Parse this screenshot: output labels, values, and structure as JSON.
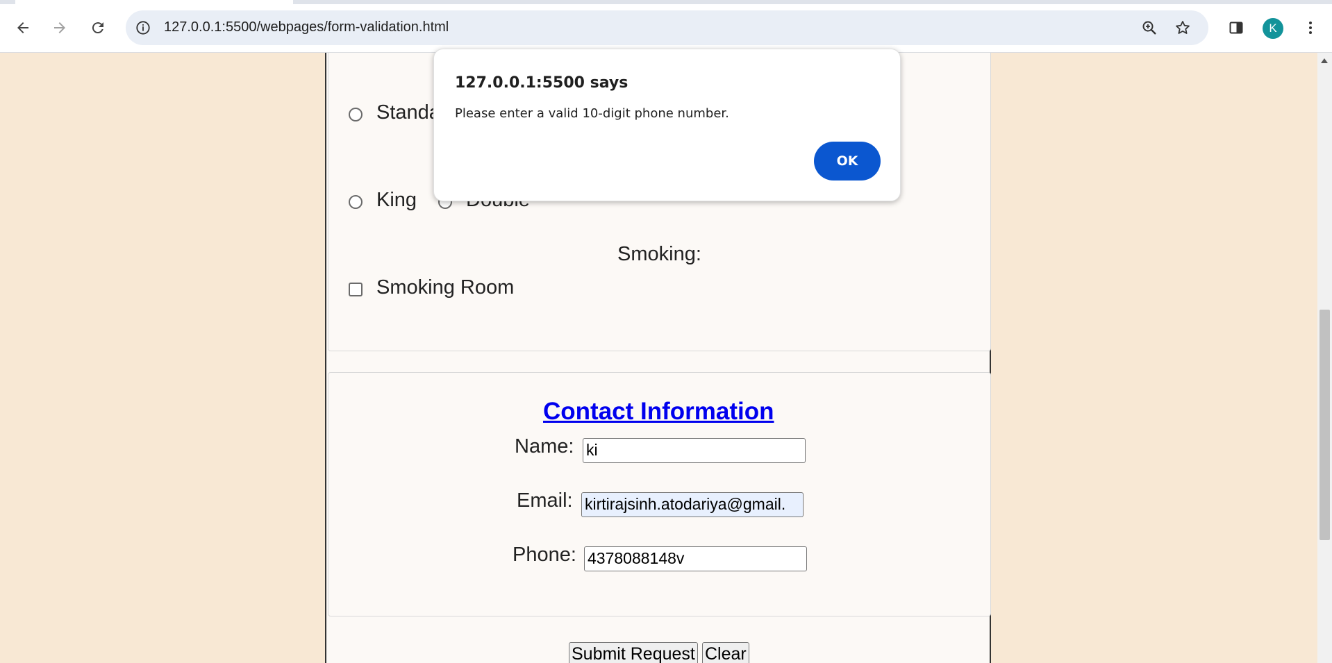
{
  "browser": {
    "url": "127.0.0.1:5500/webpages/form-validation.html",
    "avatar_initial": "K",
    "icons": {
      "back": "arrow-left-icon",
      "forward": "arrow-right-icon",
      "reload": "reload-icon",
      "site_info": "info-icon",
      "zoom": "zoom-icon",
      "bookmark": "star-icon",
      "side_panel": "side-panel-icon",
      "menu": "kebab-menu-icon"
    }
  },
  "room_section": {
    "room_type_options": [
      "Standa"
    ],
    "bed_options": [
      "King",
      "Double"
    ],
    "smoking_heading": "Smoking:",
    "smoking_option": "Smoking Room"
  },
  "contact_section": {
    "title": "Contact Information",
    "name_label": "Name:",
    "name_value": "ki",
    "email_label": "Email:",
    "email_value": "kirtirajsinh.atodariya@gmail.",
    "phone_label": "Phone:",
    "phone_value": "4378088148v"
  },
  "actions": {
    "submit_label": "Submit Request",
    "clear_label": "Clear"
  },
  "alert": {
    "title": "127.0.0.1:5500 says",
    "message": "Please enter a valid 10-digit phone number.",
    "ok_label": "OK",
    "ok_color": "#0b57d0"
  },
  "colors": {
    "page_background": "#f8e8d4",
    "form_background": "#fcf9f6",
    "link_blue": "#0000ee"
  }
}
